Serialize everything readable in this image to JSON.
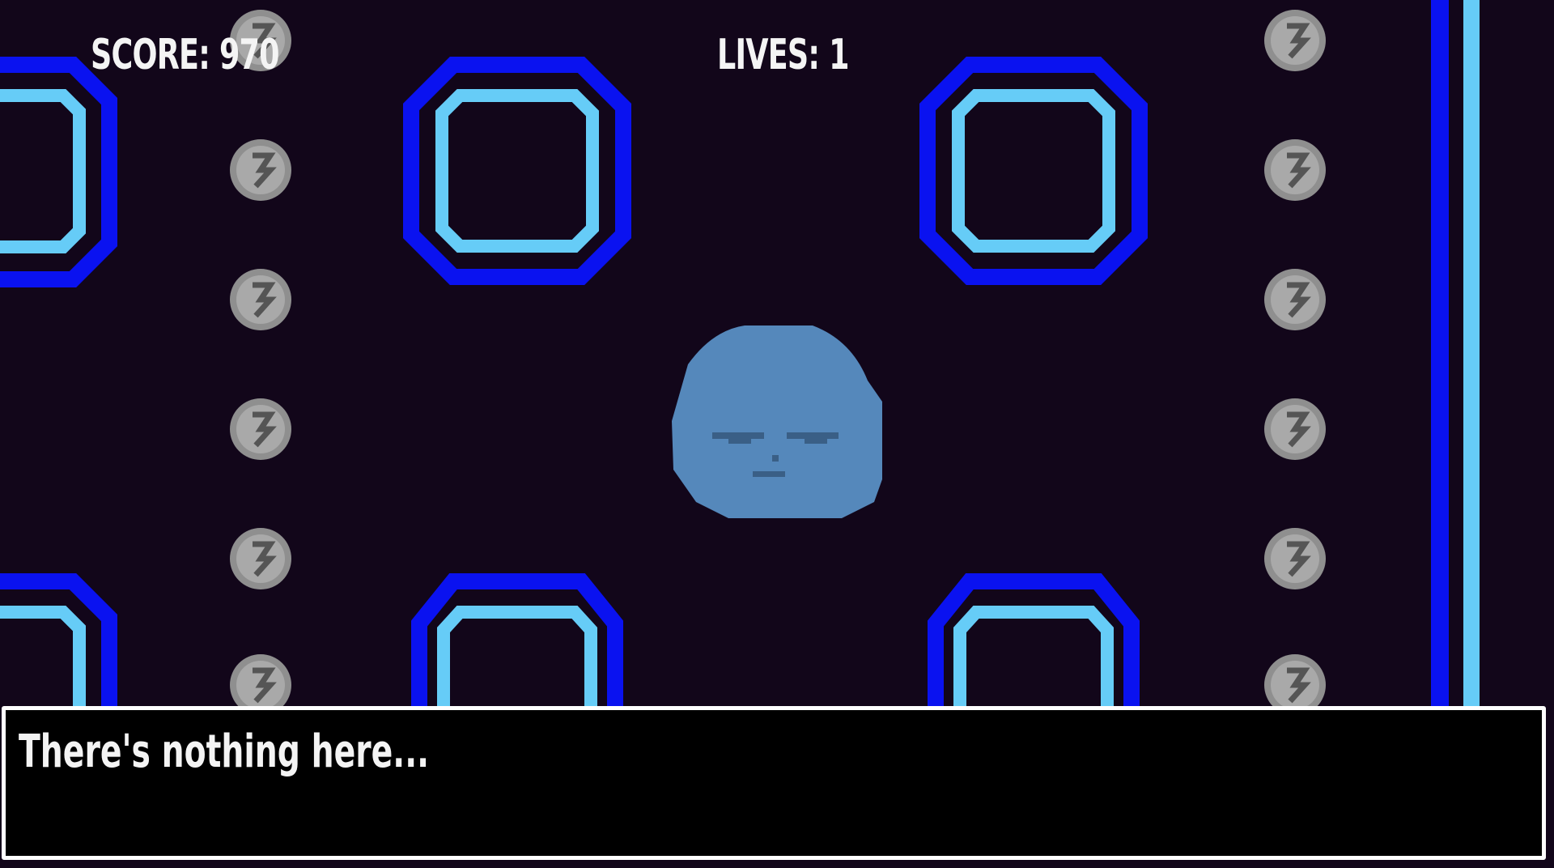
{
  "hud": {
    "score_text": "SCORE: 970",
    "lives_text": "LIVES: 1"
  },
  "dialog": {
    "message": "There's nothing here..."
  },
  "colors": {
    "background": "#12061a",
    "wall_outer": "#0a12f0",
    "wall_inner": "#66ccf7",
    "coin": "#9a9a9a",
    "player": "#5588bb",
    "text": "#f4f4f4",
    "dialog_bg": "#000000",
    "dialog_border": "#ffffff"
  },
  "entities": {
    "player": "blue-blob-character",
    "pellets": "gray-coin"
  }
}
